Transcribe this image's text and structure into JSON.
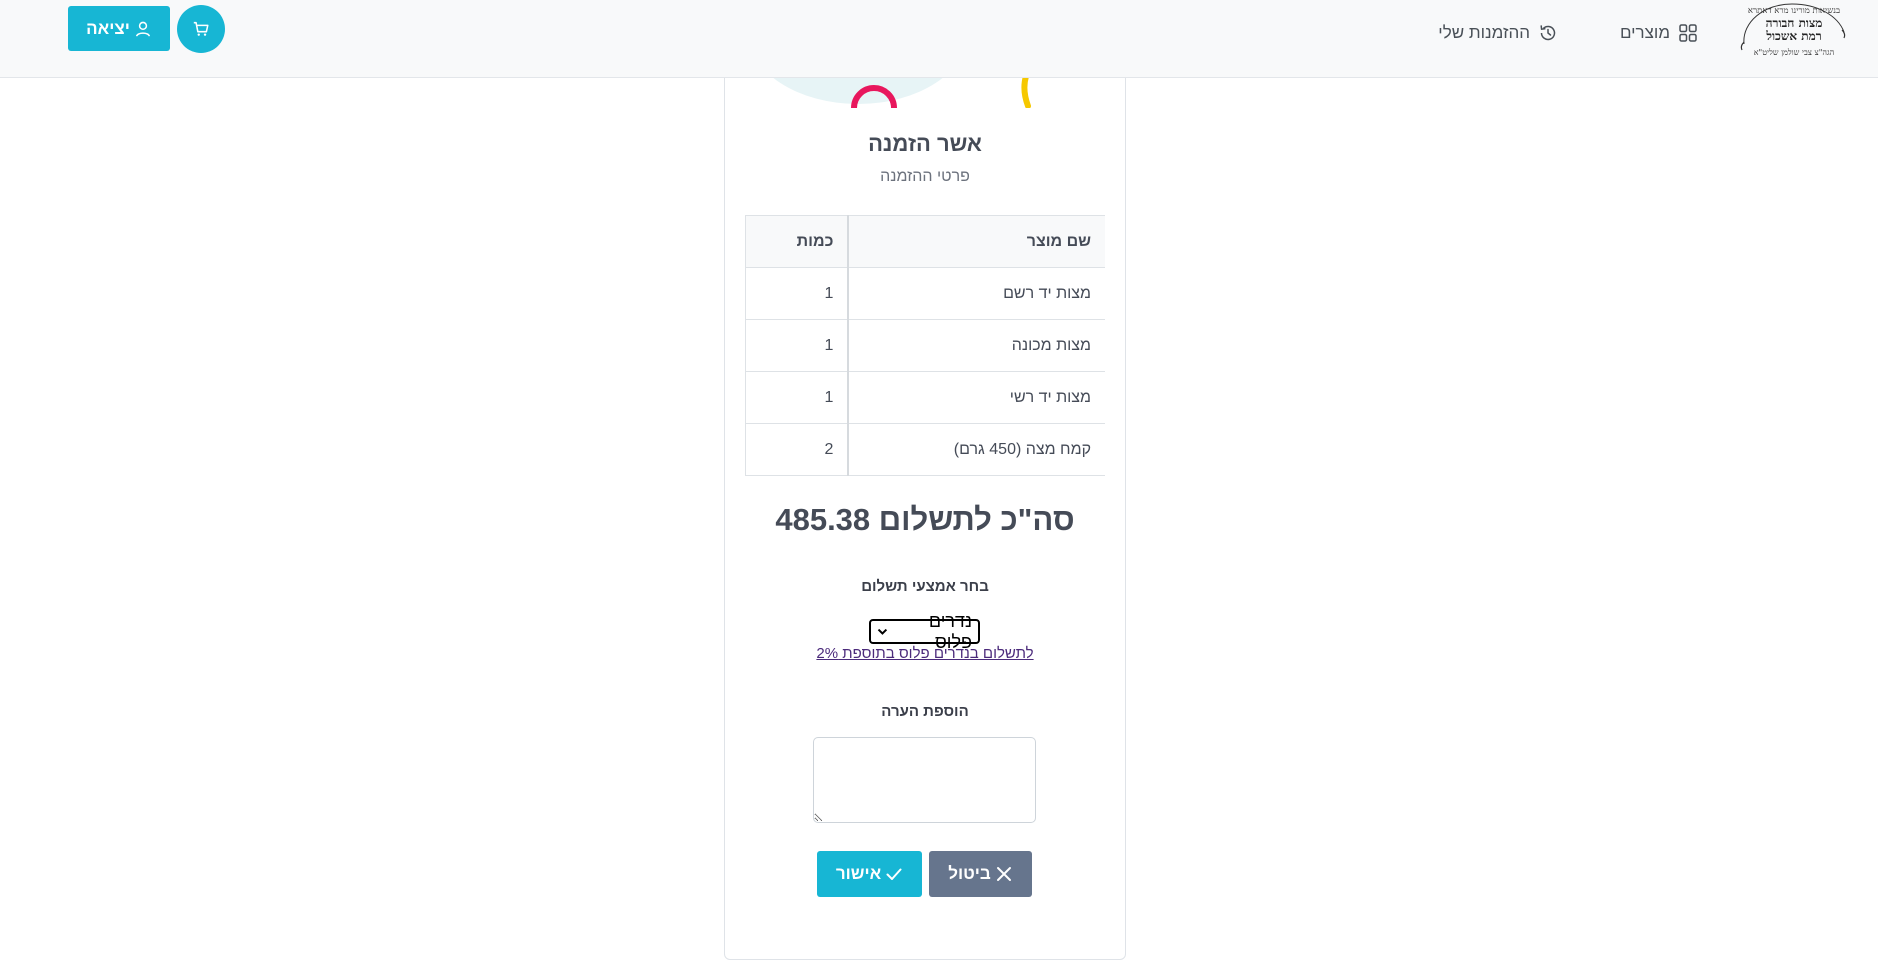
{
  "nav": {
    "logo": {
      "top_text": "בנשיאות מורינו מרא דאתרא",
      "line1": "מצות חבורה",
      "line2": "רמת אשכול",
      "bottom_text": "הגה\"צ צבי שולמן שליט\"א"
    },
    "products_label": "מוצרים",
    "orders_label": "ההזמנות שלי",
    "logout_label": "יציאה"
  },
  "page": {
    "title": "אשר הזמנה",
    "subtitle": "פרטי ההזמנה"
  },
  "table": {
    "headers": {
      "name": "שם מוצר",
      "qty": "כמות"
    },
    "rows": [
      {
        "name": "מצות יד רשם",
        "qty": "1"
      },
      {
        "name": "מצות מכונה",
        "qty": "1"
      },
      {
        "name": "מצות יד רשי",
        "qty": "1"
      },
      {
        "name": "קמח מצה (450 גרם)",
        "qty": "2"
      }
    ]
  },
  "total": {
    "label": "סה\"כ לתשלום",
    "amount": "485.38"
  },
  "payment": {
    "label": "בחר אמצעי תשלום",
    "selected": "נדרים פלוס",
    "link": "לתשלום בנדרים פלוס בתוספת 2%"
  },
  "note": {
    "label": "הוספת הערה",
    "value": ""
  },
  "buttons": {
    "cancel": "ביטול",
    "confirm": "אישור"
  },
  "colors": {
    "accent": "#17b6d4",
    "cancel": "#66758d",
    "text": "#454b57",
    "link": "#4b2a7b"
  }
}
